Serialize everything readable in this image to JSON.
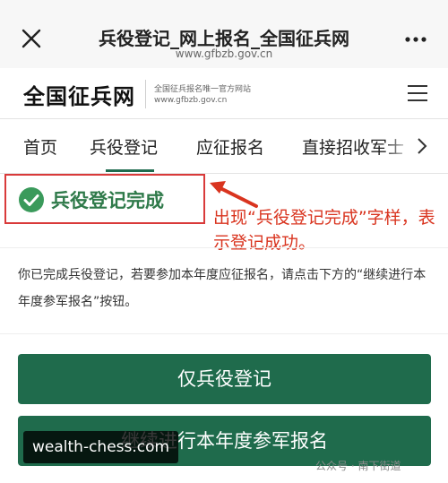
{
  "window": {
    "title": "兵役登记_网上报名_全国征兵网",
    "url": "www.gfbzb.gov.cn",
    "close_icon": "close-icon",
    "more_icon": "more-icon"
  },
  "site": {
    "logo": "全国征兵网",
    "subtitle_line1": "全国征兵报名唯一官方网站",
    "subtitle_line2": "www.gfbzb.gov.cn",
    "menu_icon": "menu-icon"
  },
  "tabs": [
    {
      "label": "首页",
      "active": false
    },
    {
      "label": "兵役登记",
      "active": true
    },
    {
      "label": "应征报名",
      "active": false
    },
    {
      "label": "直接招收军士",
      "active": false
    }
  ],
  "status": {
    "text": "兵役登记完成",
    "icon": "check-circle-icon",
    "color": "#2f7a4a"
  },
  "annotation": {
    "text": "出现“兵役登记完成”字样，表示登记成功。",
    "color": "#d9341f"
  },
  "description": "你已完成兵役登记，若要参加本年度应征报名，请点击下方的“继续进行本年度参军报名”按钮。",
  "buttons": {
    "register_only": "仅兵役登记",
    "continue_enlist": "继续进行本年度参军报名",
    "color": "#1f6b4c"
  },
  "watermarks": {
    "left": "wealth-chess.com",
    "right": "公众号 · 南下街道"
  }
}
